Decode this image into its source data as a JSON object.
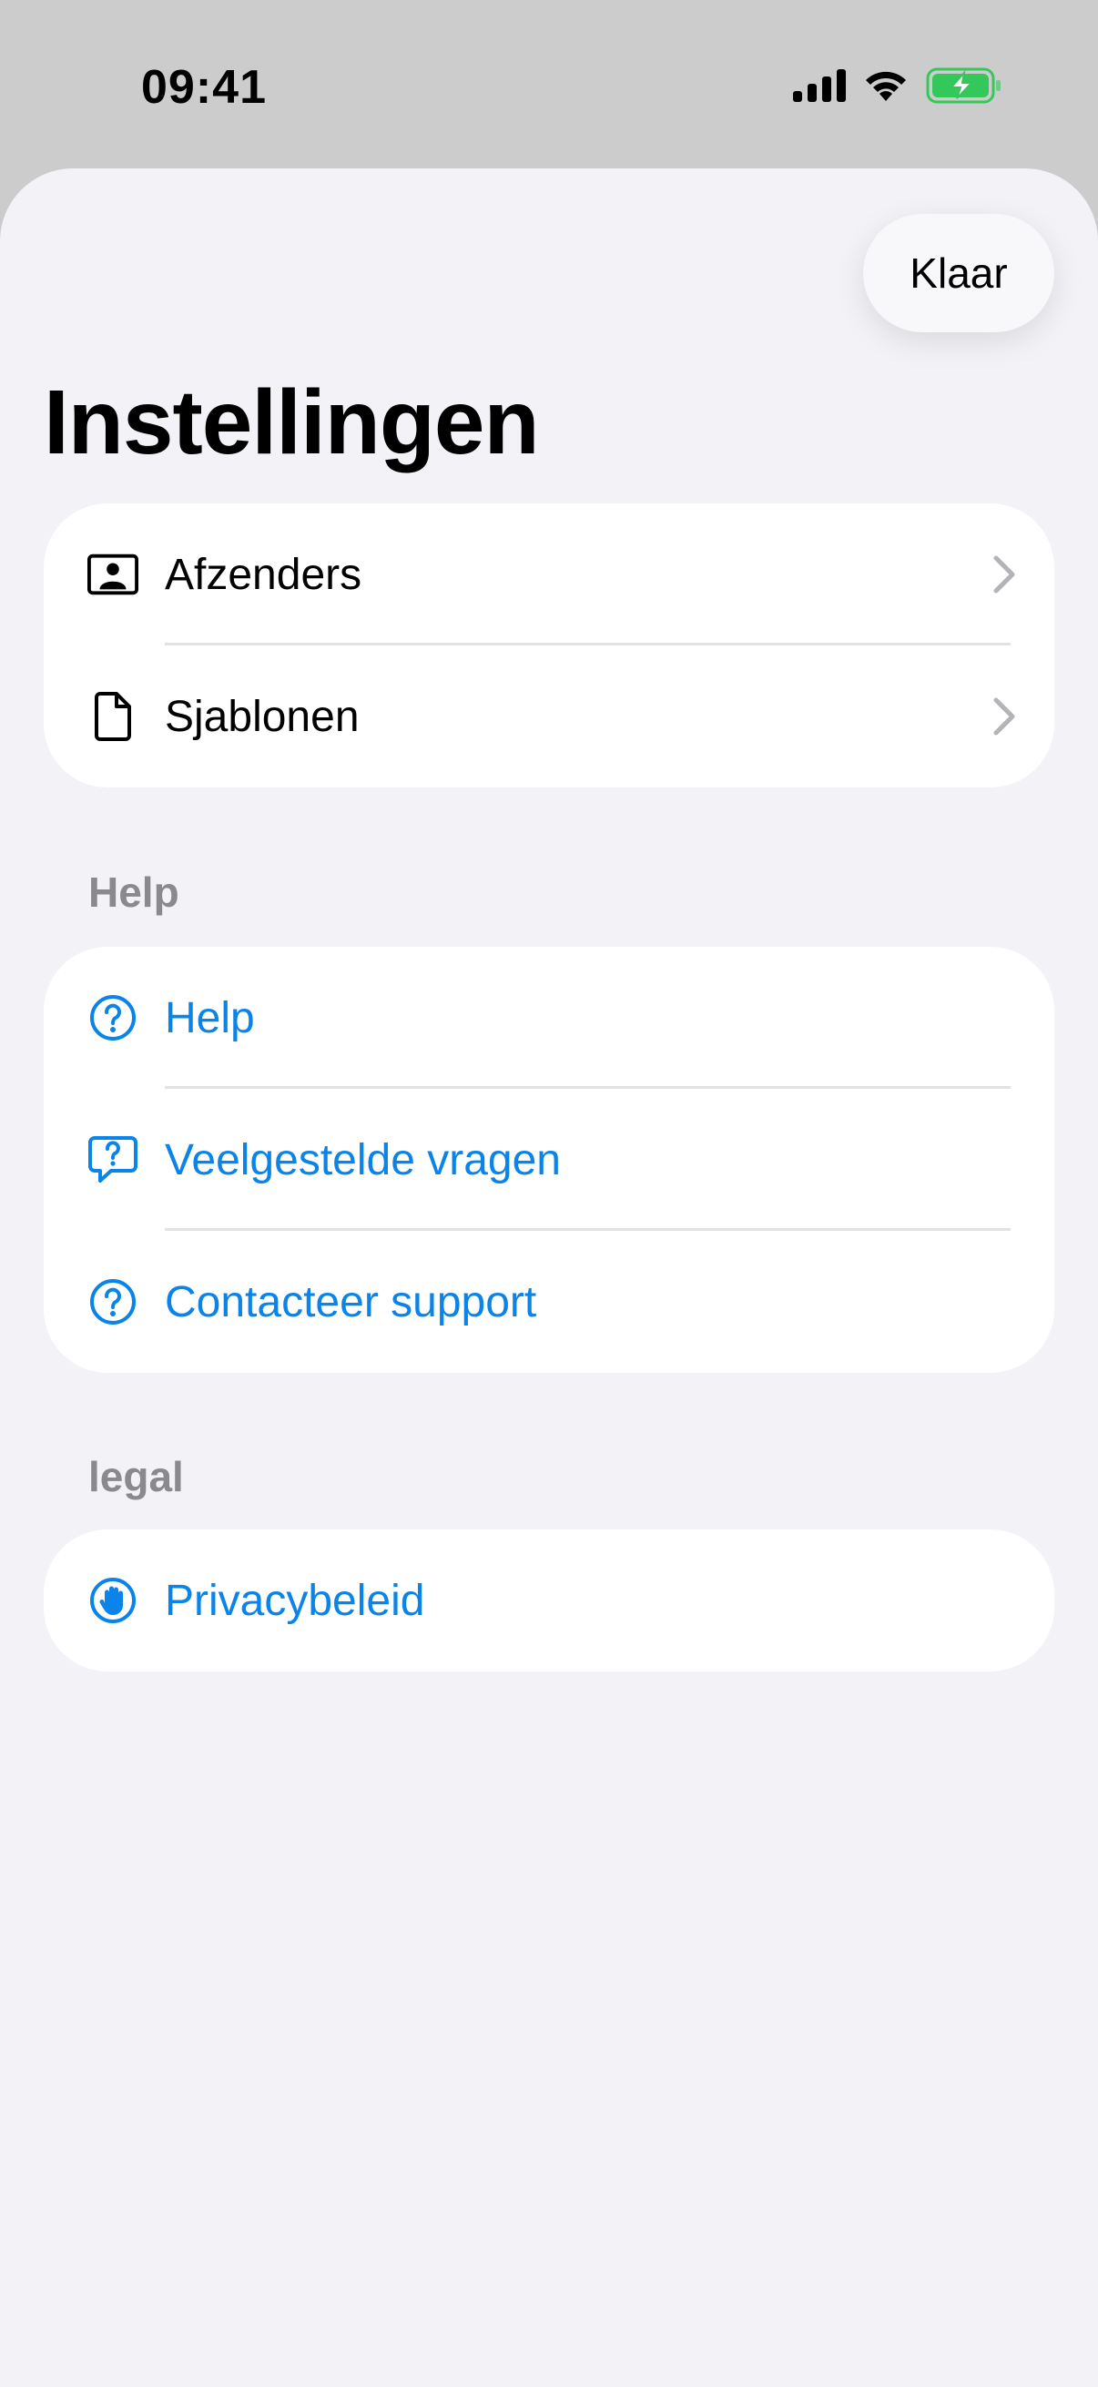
{
  "status": {
    "time": "09:41"
  },
  "sheet": {
    "done_label": "Klaar",
    "title": "Instellingen"
  },
  "groups": {
    "main": [
      {
        "label": "Afzenders",
        "icon": "person-card-icon"
      },
      {
        "label": "Sjablonen",
        "icon": "document-icon"
      }
    ],
    "help_header": "Help",
    "help": [
      {
        "label": "Help",
        "icon": "question-circle-icon"
      },
      {
        "label": "Veelgestelde vragen",
        "icon": "question-bubble-icon"
      },
      {
        "label": "Contacteer support",
        "icon": "question-circle-icon"
      }
    ],
    "legal_header": "legal",
    "legal": [
      {
        "label": "Privacybeleid",
        "icon": "hand-raised-circle-icon"
      }
    ]
  },
  "colors": {
    "accent": "#0a84e8",
    "background": "#f2f2f7",
    "battery": "#34c759"
  }
}
